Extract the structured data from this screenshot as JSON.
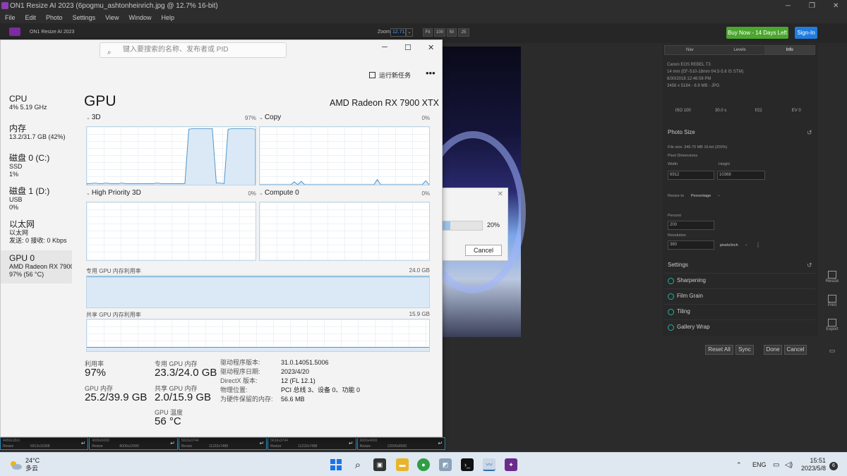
{
  "title_bar": {
    "title": "ON1 Resize AI 2023 (6pogmu_ashtonheinrich.jpg @ 12.7% 16-bit)"
  },
  "menu": [
    "File",
    "Edit",
    "Photo",
    "Settings",
    "View",
    "Window",
    "Help"
  ],
  "app": {
    "name": "ON1 Resize AI 2023",
    "zoom_label": "Zoom",
    "zoom_value": "12.71",
    "zoom_buttons": [
      "Fit",
      "100",
      "50",
      "25"
    ],
    "buy_label": "Buy Now - 14 Days Left",
    "signin_label": "Sign-In"
  },
  "right_panel": {
    "tabs": [
      "Nav",
      "Levels",
      "Info"
    ],
    "exif": [
      "Canon EOS REBEL T3",
      "14 mm (EF-S10-18mm f/4.5-5.6 IS STM)",
      "8/30/2018 12:46:08 PM",
      "3456 x 5184 - 6.9 MB - JPG"
    ],
    "exif_row": [
      "ISO 100",
      "30.0 s",
      "f/22",
      "EV 0"
    ],
    "photo_size": {
      "title": "Photo Size",
      "file_size": "File size: 346.75 MB 16-bit (200%)",
      "pixel_dims": "Pixel Dimensions",
      "width_label": "Width",
      "height_label": "Height",
      "width": "6912",
      "height": "10368",
      "resize_to_label": "Resize to",
      "resize_to": "Percentage",
      "percent_label": "Percent",
      "percent": "200",
      "resolution_label": "Resolution",
      "resolution": "360",
      "res_unit": "pixels/inch"
    },
    "settings_title": "Settings",
    "settings_items": [
      "Sharpening",
      "Film Grain",
      "Tiling",
      "Gallery Wrap"
    ],
    "buttons": {
      "reset_all": "Reset All",
      "sync": "Sync",
      "done": "Done",
      "cancel": "Cancel"
    }
  },
  "side_icons": [
    "Resize",
    "Print",
    "Export"
  ],
  "progress_dialog": {
    "percent": "20%",
    "cancel": "Cancel",
    "progress_value": 0.2
  },
  "filmstrip": [
    {
      "a": "4456x18x1",
      "b": "6912x10368"
    },
    {
      "a": "4000x6000",
      "b": "8000x12000"
    },
    {
      "a": "5616x3744",
      "b": "11232x7488"
    },
    {
      "a": "5616x3744",
      "b": "11232x7488"
    },
    {
      "a": "6000x4000",
      "b": "12000x8000"
    }
  ],
  "filmstrip_tag": "Resize",
  "task_manager": {
    "search_placeholder": "键入要搜索的名称、发布者或 PID",
    "new_task": "运行新任务",
    "nav": [
      {
        "name": "CPU",
        "sub": [
          "4%  5.19 GHz"
        ]
      },
      {
        "name": "内存",
        "sub": [
          "13.2/31.7 GB (42%)"
        ]
      },
      {
        "name": "磁盘 0 (C:)",
        "sub": [
          "SSD",
          "1%"
        ]
      },
      {
        "name": "磁盘 1 (D:)",
        "sub": [
          "USB",
          "0%"
        ]
      },
      {
        "name": "以太网",
        "sub": [
          "以太网",
          "发送: 0 接收: 0 Kbps"
        ]
      },
      {
        "name": "GPU 0",
        "sub": [
          "AMD Radeon RX 7900 XTX",
          "97% (56 °C)"
        ]
      }
    ],
    "gpu_title": "GPU",
    "gpu_model": "AMD Radeon RX 7900 XTX",
    "engines": [
      {
        "name": "3D",
        "pct": "97%"
      },
      {
        "name": "Copy",
        "pct": "0%"
      },
      {
        "name": "High Priority 3D",
        "pct": "0%"
      },
      {
        "name": "Compute 0",
        "pct": "0%"
      }
    ],
    "dedicated_label": "专用 GPU 内存利用率",
    "dedicated_max": "24.0 GB",
    "shared_label": "共享 GPU 内存利用率",
    "shared_max": "15.9 GB",
    "stats": {
      "util_label": "利用率",
      "util": "97%",
      "ded_label": "专用 GPU 内存",
      "ded": "23.3/24.0 GB",
      "gmem_label": "GPU 内存",
      "gmem": "25.2/39.9 GB",
      "shared_label": "共享 GPU 内存",
      "shared": "2.0/15.9 GB",
      "temp_label": "GPU 温度",
      "temp": "56 °C"
    },
    "details": [
      {
        "k": "驱动程序版本:",
        "v": "31.0.14051.5006"
      },
      {
        "k": "驱动程序日期:",
        "v": "2023/4/20"
      },
      {
        "k": "DirectX 版本:",
        "v": "12 (FL 12.1)"
      },
      {
        "k": "物理位置:",
        "v": "PCI 总线 3、设备 0、功能 0"
      },
      {
        "k": "为硬件保留的内存:",
        "v": "56.6 MB"
      }
    ],
    "graph_3d": [
      2,
      2,
      3,
      2,
      2,
      3,
      2,
      2,
      2,
      3,
      2,
      2,
      2,
      2,
      2,
      2,
      2,
      2,
      3,
      2,
      2,
      2,
      2,
      2,
      2,
      2,
      96,
      97,
      97,
      97,
      97,
      97,
      97,
      3,
      3,
      2,
      96,
      97,
      97,
      97,
      97,
      97,
      97,
      96
    ],
    "graph_copy": [
      0,
      0,
      0,
      0,
      0,
      0,
      0,
      0,
      0,
      0,
      5,
      0,
      6,
      0,
      0,
      0,
      0,
      0,
      0,
      0,
      0,
      0,
      0,
      0,
      0,
      0,
      0,
      0,
      0,
      0,
      0,
      0,
      0,
      0,
      9,
      0,
      0,
      0,
      0,
      0,
      0,
      0,
      0,
      0,
      0,
      0,
      0,
      0,
      7,
      0
    ],
    "dedicated_level": 0.97,
    "shared_level": 0.126
  },
  "taskbar": {
    "weather_temp": "24°C",
    "weather_desc": "多云",
    "lang": "ENG",
    "time": "15:51",
    "date": "2023/5/8",
    "notifications": "6"
  }
}
